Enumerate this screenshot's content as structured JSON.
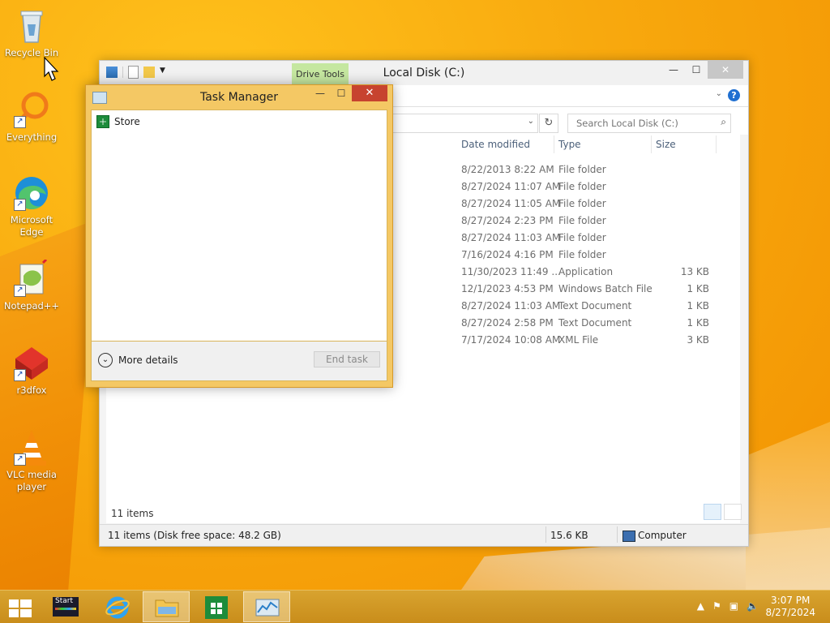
{
  "desktop": {
    "icons": [
      {
        "label": "Recycle Bin"
      },
      {
        "label": "Everything"
      },
      {
        "label": "Microsoft Edge"
      },
      {
        "label": "Notepad++"
      },
      {
        "label": "r3dfox"
      },
      {
        "label": "VLC media player"
      }
    ]
  },
  "explorer": {
    "title": "Local Disk (C:)",
    "contextual_tab": "Drive Tools",
    "search_placeholder": "Search Local Disk (C:)",
    "columns": [
      "Date modified",
      "Type",
      "Size"
    ],
    "rows": [
      {
        "date": "8/22/2013 8:22 AM",
        "type": "File folder",
        "size": ""
      },
      {
        "date": "8/27/2024 11:07 AM",
        "type": "File folder",
        "size": ""
      },
      {
        "date": "8/27/2024 11:05 AM",
        "type": "File folder",
        "size": ""
      },
      {
        "date": "8/27/2024 2:23 PM",
        "type": "File folder",
        "size": ""
      },
      {
        "date": "8/27/2024 11:03 AM",
        "type": "File folder",
        "size": ""
      },
      {
        "date": "7/16/2024 4:16 PM",
        "type": "File folder",
        "size": ""
      },
      {
        "date": "11/30/2023 11:49 ...",
        "type": "Application",
        "size": "13 KB"
      },
      {
        "date": "12/1/2023 4:53 PM",
        "type": "Windows Batch File",
        "size": "1 KB"
      },
      {
        "date": "8/27/2024 11:03 AM",
        "type": "Text Document",
        "size": "1 KB"
      },
      {
        "date": "8/27/2024 2:58 PM",
        "type": "Text Document",
        "size": "1 KB"
      },
      {
        "date": "7/17/2024 10:08 AM",
        "type": "XML File",
        "size": "3 KB"
      }
    ],
    "item_count": "11 items",
    "status": {
      "left": "11 items (Disk free space: 48.2 GB)",
      "size": "15.6 KB",
      "location": "Computer"
    }
  },
  "taskmgr": {
    "title": "Task Manager",
    "apps": [
      {
        "name": "Store"
      }
    ],
    "more_details": "More details",
    "end_task": "End task"
  },
  "taskbar": {
    "start_label": "Start",
    "time": "3:07 PM",
    "date": "8/27/2024"
  }
}
